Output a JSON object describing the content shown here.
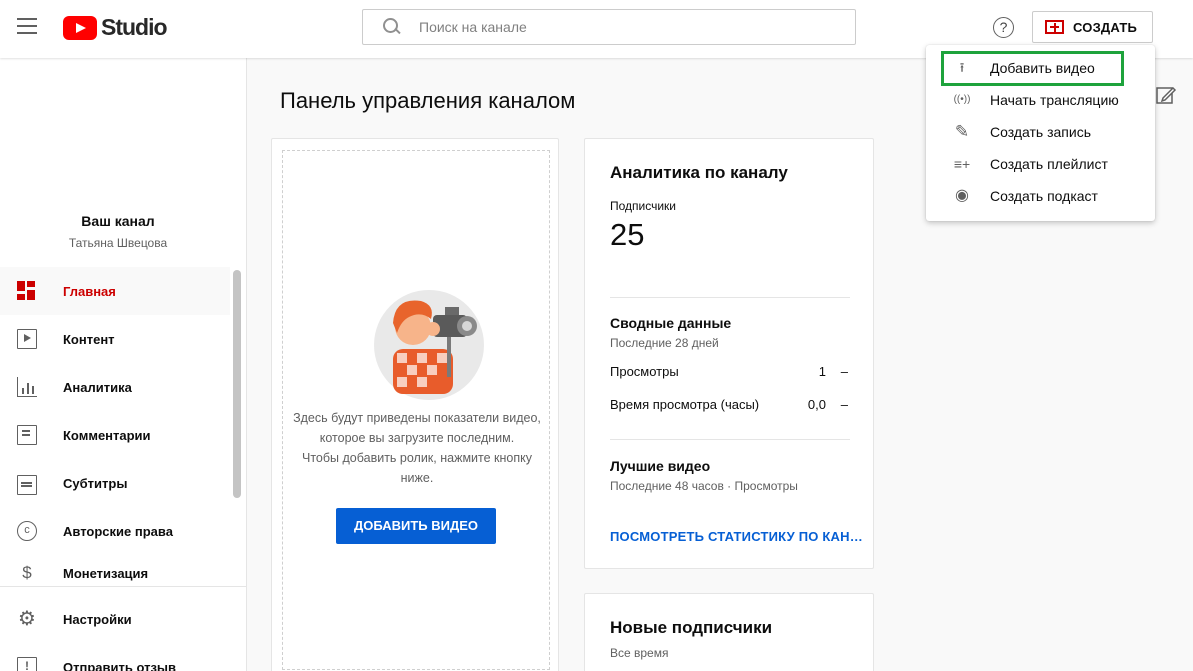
{
  "header": {
    "logo_text": "Studio",
    "search_placeholder": "Поиск на канале",
    "create_label": "СОЗДАТЬ",
    "help_label": "?"
  },
  "sidebar": {
    "channel_title": "Ваш канал",
    "channel_name": "Татьяна Швецова",
    "items": [
      {
        "label": "Главная",
        "icon": "dashboard-icon",
        "active": true
      },
      {
        "label": "Контент",
        "icon": "content-icon"
      },
      {
        "label": "Аналитика",
        "icon": "analytics-icon"
      },
      {
        "label": "Комментарии",
        "icon": "comments-icon"
      },
      {
        "label": "Субтитры",
        "icon": "subtitles-icon"
      },
      {
        "label": "Авторские права",
        "icon": "copyright-icon"
      },
      {
        "label": "Монетизация",
        "icon": "monetization-icon"
      }
    ],
    "bottom_items": [
      {
        "label": "Настройки",
        "icon": "settings-icon"
      },
      {
        "label": "Отправить отзыв",
        "icon": "feedback-icon"
      }
    ],
    "copyright_glyph": "c",
    "money_glyph": "$",
    "gear_glyph": "⚙",
    "feedback_glyph": "!"
  },
  "main": {
    "page_title": "Панель управления каналом",
    "upload_card": {
      "text_lines": [
        "Здесь будут приведены показатели видео,",
        "которое вы загрузите последним.",
        "Чтобы добавить ролик, нажмите кнопку",
        "ниже."
      ],
      "button_label": "ДОБАВИТЬ ВИДЕО"
    },
    "analytics_card": {
      "title": "Аналитика по каналу",
      "subscribers_label": "Подписчики",
      "subscribers_value": "25",
      "summary_title": "Сводные данные",
      "summary_period": "Последние 28 дней",
      "rows": [
        {
          "label": "Просмотры",
          "value": "1",
          "delta": "–"
        },
        {
          "label": "Время просмотра (часы)",
          "value": "0,0",
          "delta": "–"
        }
      ],
      "top_videos_title": "Лучшие видео",
      "top_videos_period": "Последние 48 часов · Просмотры",
      "link_label": "ПОСМОТРЕТЬ СТАТИСТИКУ ПО КАНАЛУ"
    },
    "subscribers_card": {
      "title": "Новые подписчики",
      "period": "Все время"
    }
  },
  "create_menu": {
    "items": [
      {
        "label": "Добавить видео",
        "icon": "upload-icon",
        "glyph": "⭱"
      },
      {
        "label": "Начать трансляцию",
        "icon": "live-icon",
        "glyph": "((•))"
      },
      {
        "label": "Создать запись",
        "icon": "post-icon",
        "glyph": "✎"
      },
      {
        "label": "Создать плейлист",
        "icon": "playlist-add-icon",
        "glyph": "≡+"
      },
      {
        "label": "Создать подкаст",
        "icon": "podcast-icon",
        "glyph": "◉"
      }
    ]
  },
  "colors": {
    "accent_red": "#cc0000",
    "link_blue": "#065fd4",
    "highlight_green": "#1ea33c"
  }
}
